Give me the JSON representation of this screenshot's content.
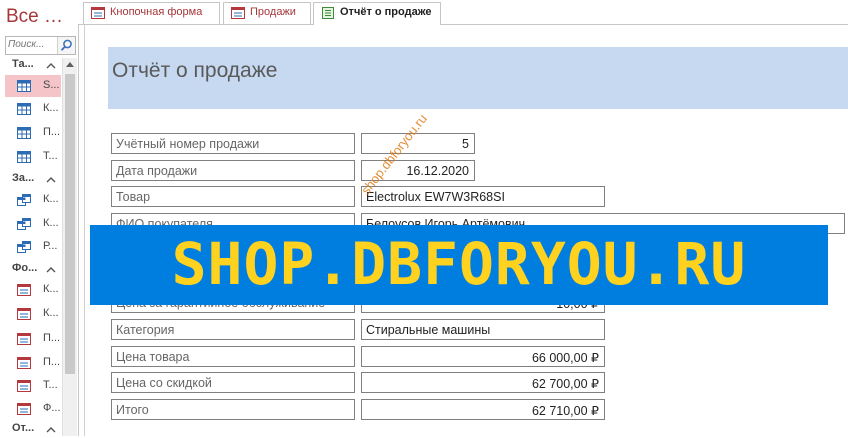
{
  "nav": {
    "title": "Все …",
    "search_placeholder": "Поиск...",
    "groups": [
      {
        "label": "Та...",
        "items": [
          "S...",
          "К...",
          "П...",
          "Т..."
        ]
      },
      {
        "label": "За...",
        "items": [
          "К...",
          "К...",
          "Р..."
        ]
      },
      {
        "label": "Фо...",
        "items": [
          "К...",
          "К...",
          "П...",
          "П...",
          "Т...",
          "Ф..."
        ]
      },
      {
        "label": "От..."
      }
    ]
  },
  "tabs": [
    {
      "label": "Кнопочная форма",
      "active": false
    },
    {
      "label": "Продажи",
      "active": false
    },
    {
      "label": "Отчёт о продаже",
      "active": true
    }
  ],
  "report": {
    "title": "Отчёт о продаже",
    "fields": [
      {
        "label": "Учётный номер продажи",
        "value": "5"
      },
      {
        "label": "Дата продажи",
        "value": "16.12.2020"
      },
      {
        "label": "Товар",
        "value": "Electrolux EW7W3R68SI"
      },
      {
        "label": "ФИО покупателя",
        "value": "Белоусов Игорь Артёмович"
      },
      {
        "label": "Цена за гарантийное обслуживание",
        "value": "10,00 ₽"
      },
      {
        "label": "Категория",
        "value": "Стиральные машины"
      },
      {
        "label": "Цена товара",
        "value": "66 000,00 ₽"
      },
      {
        "label": "Цена со скидкой",
        "value": "62 700,00 ₽"
      },
      {
        "label": "Итого",
        "value": "62 710,00 ₽"
      }
    ]
  },
  "watermark": {
    "banner": "SHOP.DBFORYOU.RU",
    "diagonal": "shop.dbforyou.ru"
  },
  "colors": {
    "accent": "#a4373a",
    "header_band": "#c6d9f1",
    "banner_bg": "#007ee0",
    "banner_text": "#ffd21f"
  }
}
